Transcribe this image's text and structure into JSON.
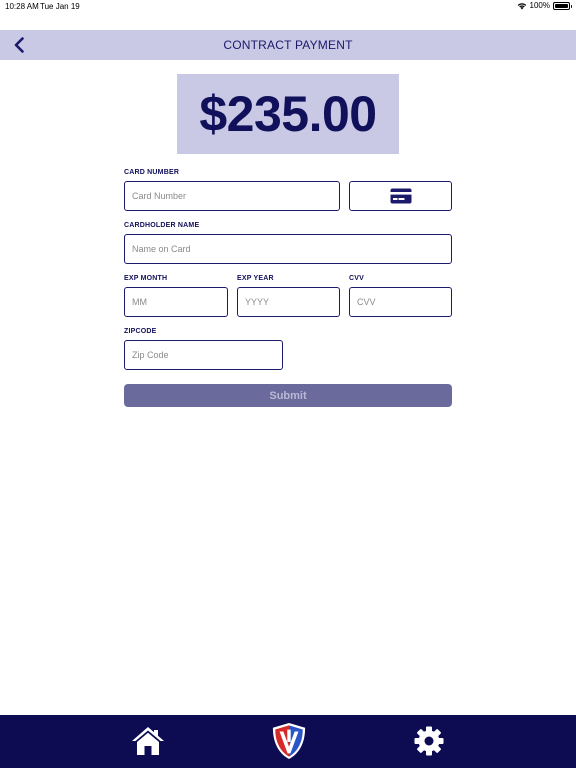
{
  "status_bar": {
    "time": "10:28 AM",
    "date": "Tue Jan 19",
    "battery": "100%"
  },
  "nav": {
    "title": "CONTRACT PAYMENT"
  },
  "payment": {
    "amount": "$235.00"
  },
  "form": {
    "card_number": {
      "label": "CARD NUMBER",
      "placeholder": "Card Number",
      "value": ""
    },
    "cardholder": {
      "label": "CARDHOLDER NAME",
      "placeholder": "Name on Card",
      "value": ""
    },
    "exp_month": {
      "label": "EXP MONTH",
      "placeholder": "MM",
      "value": ""
    },
    "exp_year": {
      "label": "EXP YEAR",
      "placeholder": "YYYY",
      "value": ""
    },
    "cvv": {
      "label": "CVV",
      "placeholder": "CVV",
      "value": ""
    },
    "zipcode": {
      "label": "ZIPCODE",
      "placeholder": "Zip Code",
      "value": ""
    },
    "submit_label": "Submit"
  },
  "icons": {
    "back": "chevron-left-icon",
    "card_scan": "credit-card-icon",
    "home": "home-icon",
    "logo": "shield-logo-icon",
    "settings": "gear-icon",
    "wifi": "wifi-icon",
    "battery": "battery-icon"
  },
  "colors": {
    "primary": "#1b1a6b",
    "header_bg": "#c9c8e5",
    "tabbar_bg": "#0d0c52",
    "submit_bg": "#6a6a9c",
    "logo_red": "#d42a2a",
    "logo_blue": "#2a55c7"
  }
}
